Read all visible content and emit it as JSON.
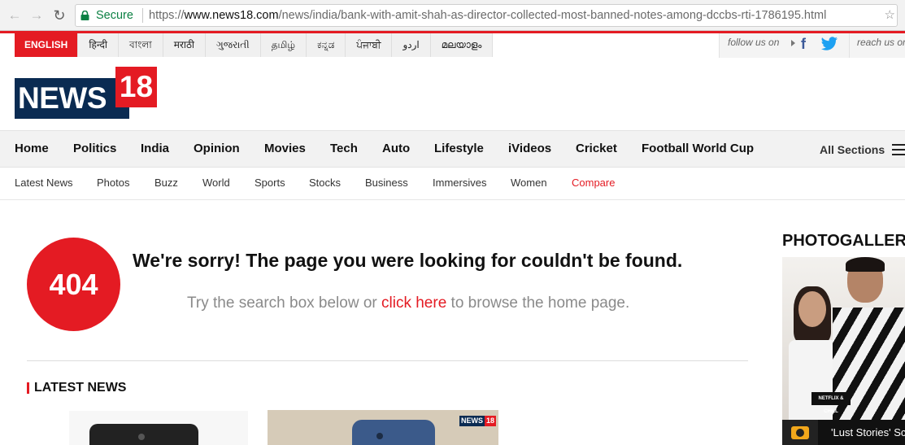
{
  "browser": {
    "secure_label": "Secure",
    "url_scheme": "https://",
    "url_host": "www.news18.com",
    "url_path": "/news/india/bank-with-amit-shah-as-director-collected-most-banned-notes-among-dccbs-rti-1786195.html"
  },
  "languages": [
    "ENGLISH",
    "हिन्दी",
    "বাংলা",
    "मराठी",
    "ગુજરાતી",
    "தமிழ்",
    "ಕನ್ನಡ",
    "ਪੰਜਾਬੀ",
    "اردو",
    "മലയാളം"
  ],
  "social": {
    "follow_label": "follow us on",
    "reach_label": "reach us on"
  },
  "logo": {
    "news": "NEWS",
    "number": "18"
  },
  "main_nav": [
    "Home",
    "Politics",
    "India",
    "Opinion",
    "Movies",
    "Tech",
    "Auto",
    "Lifestyle",
    "iVideos",
    "Cricket",
    "Football World Cup"
  ],
  "all_sections_label": "All Sections",
  "sub_nav": [
    "Latest News",
    "Photos",
    "Buzz",
    "World",
    "Sports",
    "Stocks",
    "Business",
    "Immersives",
    "Women",
    "Compare"
  ],
  "error": {
    "code": "404",
    "title": "We're sorry! The page you were looking for couldn't be found.",
    "sub_before": "Try the search box below or ",
    "sub_link": "click here",
    "sub_after": " to browse the home page."
  },
  "latest_news_title": "LATEST NEWS",
  "thumb_logo": {
    "news": "NEWS",
    "number": "18"
  },
  "photogallery": {
    "title": "PHOTOGALLERY",
    "tshirt_text": "NETFLIX & CHILL",
    "caption": "'Lust Stories' Screening"
  },
  "colors": {
    "brand_red": "#e41b23",
    "brand_navy": "#0a2b52"
  }
}
